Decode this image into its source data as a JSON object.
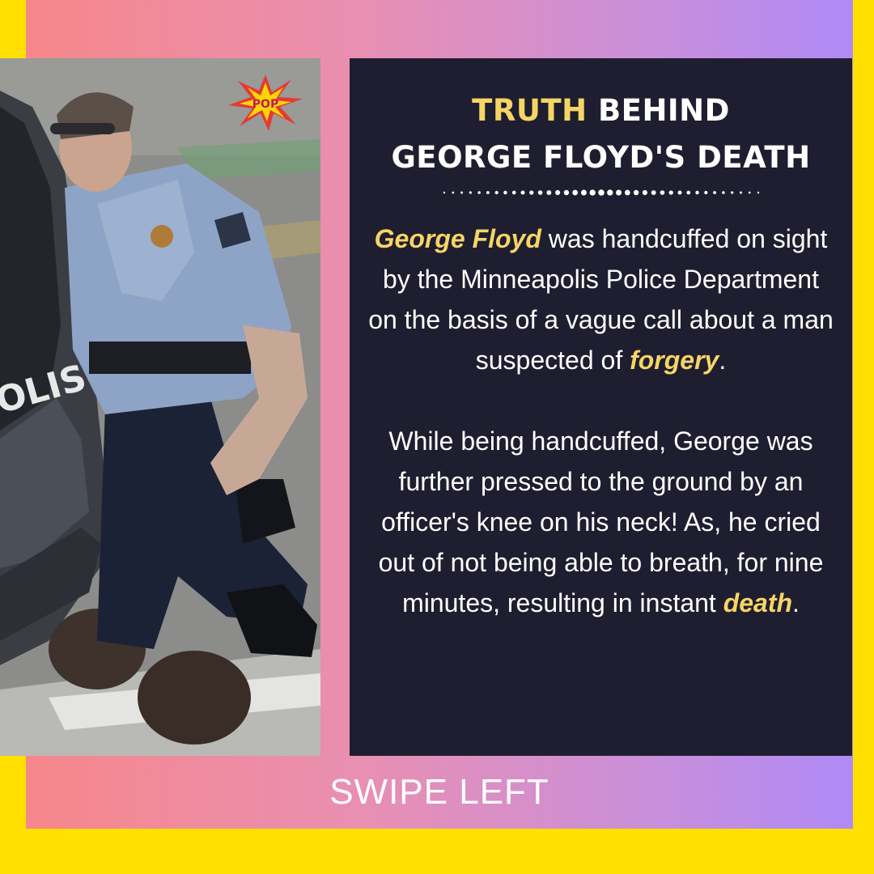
{
  "title": {
    "highlight": "TRUTH",
    "line1_rest": " BEHIND",
    "line2": "GEORGE FLOYD'S DEATH"
  },
  "paragraph1": {
    "name": "George Floyd",
    "text_a": " was handcuffed on sight by the Minneapolis Police Department on the basis of a vague call about a man suspected of ",
    "emphasis": "forgery",
    "end": "."
  },
  "paragraph2": {
    "text": "While being handcuffed, George was further pressed to the ground by an officer's knee on his neck! As, he cried out of not being able to breath, for nine minutes, resulting in instant ",
    "emphasis": "death",
    "end": "."
  },
  "footer": {
    "label": "SWIPE LEFT"
  },
  "photo": {
    "car_lettering": "OLIS",
    "logo_text": "POP"
  },
  "colors": {
    "border": "#FFE000",
    "panel": "#1F1E30",
    "highlight": "#F6D565",
    "gradient_start": "#F6878A",
    "gradient_end": "#B08AF6"
  }
}
